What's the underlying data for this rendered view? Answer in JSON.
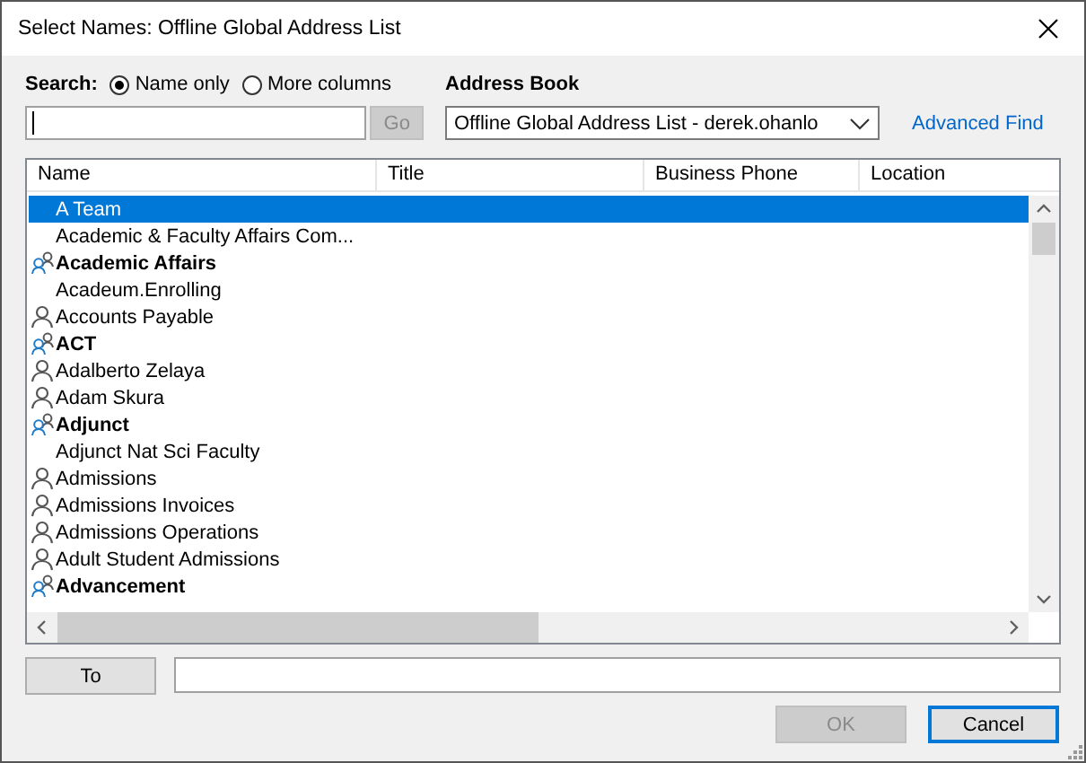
{
  "window": {
    "title": "Select Names: Offline Global Address List"
  },
  "search": {
    "label": "Search:",
    "options": [
      {
        "label": "Name only",
        "selected": true
      },
      {
        "label": "More columns",
        "selected": false
      }
    ],
    "go_button": {
      "label": "Go",
      "disabled": true
    }
  },
  "address_book": {
    "label": "Address Book",
    "value": "Offline Global Address List - derek.ohanlo"
  },
  "advanced_find": "Advanced Find",
  "table": {
    "columns": [
      "Name",
      "Title",
      "Business Phone",
      "Location"
    ],
    "rows": [
      {
        "name": "A Team",
        "kind": "none",
        "selected": true
      },
      {
        "name": "Academic & Faculty Affairs Com...",
        "kind": "none",
        "selected": false
      },
      {
        "name": "Academic Affairs",
        "kind": "group",
        "selected": false
      },
      {
        "name": "Acadeum.Enrolling",
        "kind": "none",
        "selected": false
      },
      {
        "name": "Accounts Payable",
        "kind": "person",
        "selected": false
      },
      {
        "name": "ACT",
        "kind": "group",
        "selected": false
      },
      {
        "name": "Adalberto Zelaya",
        "kind": "person",
        "selected": false
      },
      {
        "name": "Adam Skura",
        "kind": "person",
        "selected": false
      },
      {
        "name": "Adjunct",
        "kind": "group",
        "selected": false
      },
      {
        "name": "Adjunct Nat Sci Faculty",
        "kind": "none",
        "selected": false
      },
      {
        "name": "Admissions",
        "kind": "person",
        "selected": false
      },
      {
        "name": "Admissions Invoices",
        "kind": "person",
        "selected": false
      },
      {
        "name": "Admissions Operations",
        "kind": "person",
        "selected": false
      },
      {
        "name": "Adult Student Admissions",
        "kind": "person",
        "selected": false
      },
      {
        "name": "Advancement",
        "kind": "group",
        "selected": false
      }
    ]
  },
  "to_button": "To",
  "buttons": [
    {
      "label": "OK",
      "disabled": true
    },
    {
      "label": "Cancel",
      "disabled": false
    }
  ]
}
